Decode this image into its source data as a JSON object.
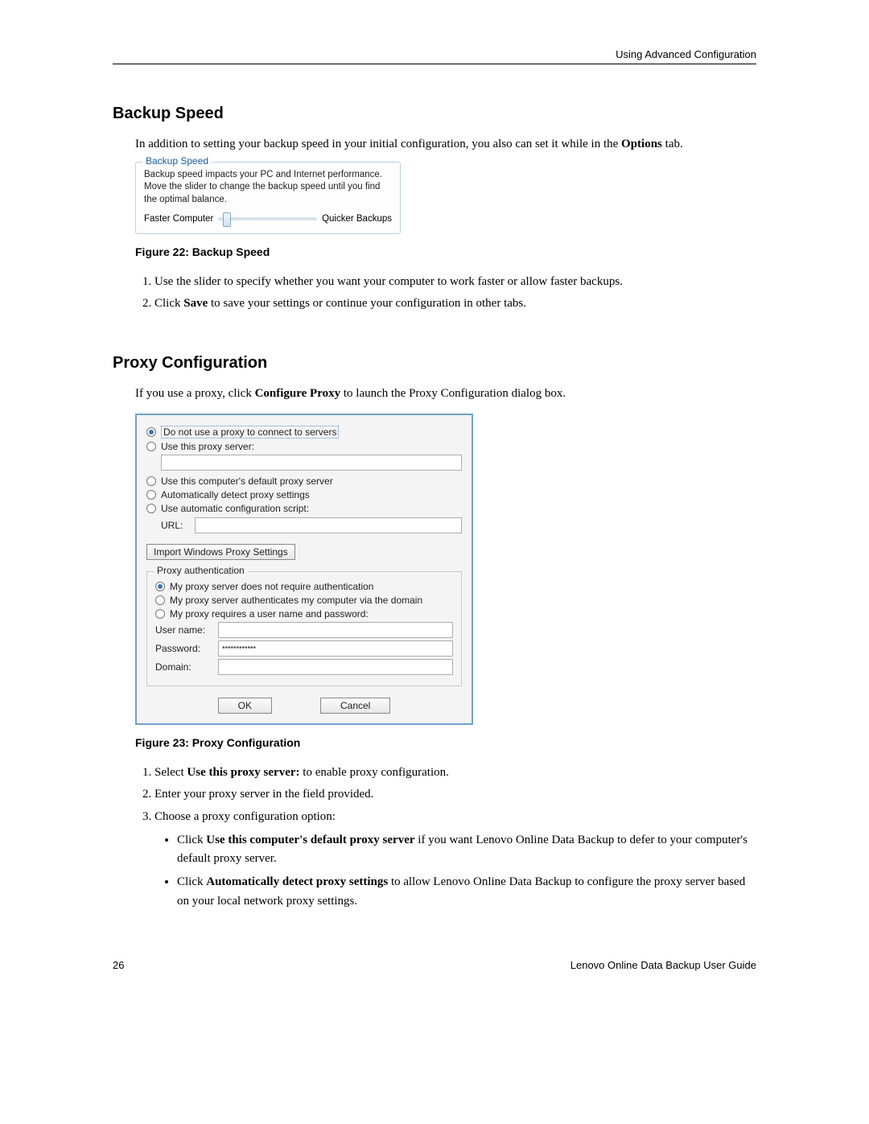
{
  "header": {
    "section": "Using Advanced Configuration"
  },
  "backup_speed": {
    "heading": "Backup Speed",
    "intro_pre": "In addition to setting your backup speed in your initial configuration, you also can set it while in the ",
    "intro_bold": "Options",
    "intro_post": " tab.",
    "fs_legend": "Backup Speed",
    "fs_desc": "Backup speed impacts your PC and Internet performance. Move the slider to change the backup speed until you find the optimal balance.",
    "slider_left": "Faster Computer",
    "slider_right": "Quicker Backups",
    "figure_caption": "Figure 22: Backup Speed",
    "step1": "Use the slider to specify whether you want your computer to work faster or allow faster backups.",
    "step2_pre": "Click ",
    "step2_bold": "Save",
    "step2_post": " to save your settings or continue your configuration in other tabs."
  },
  "proxy": {
    "heading": "Proxy Configuration",
    "intro_pre": "If you use a proxy, click ",
    "intro_bold": "Configure Proxy",
    "intro_post": " to launch the Proxy Configuration dialog box.",
    "opt_no_proxy": "Do not use a proxy to connect to servers",
    "opt_use_server": "Use this proxy server:",
    "opt_default": "Use this computer's default proxy server",
    "opt_auto_detect": "Automatically detect proxy settings",
    "opt_auto_script": "Use automatic configuration script:",
    "url_label": "URL:",
    "import_btn": "Import Windows Proxy Settings",
    "auth_legend": "Proxy authentication",
    "auth_noreq": "My proxy server does not require authentication",
    "auth_domain": "My proxy server authenticates my computer via the domain",
    "auth_userpass": "My proxy requires a user name and password:",
    "lbl_user": "User name:",
    "lbl_pass": "Password:",
    "lbl_domain": "Domain:",
    "pass_value": "••••••••••••",
    "btn_ok": "OK",
    "btn_cancel": "Cancel",
    "figure_caption": "Figure 23: Proxy Configuration",
    "step1_pre": "Select ",
    "step1_bold": "Use this proxy server:",
    "step1_post": " to enable proxy configuration.",
    "step2": "Enter your proxy server in the field provided.",
    "step3": "Choose a proxy configuration option:",
    "bullet1_pre": "Click ",
    "bullet1_bold": "Use this computer's default proxy server",
    "bullet1_post": " if you want Lenovo Online Data Backup to defer to your computer's default proxy server.",
    "bullet2_pre": "Click ",
    "bullet2_bold": "Automatically detect proxy settings",
    "bullet2_post": " to allow Lenovo Online Data Backup to configure the proxy server based on your local network proxy settings."
  },
  "footer": {
    "page_number": "26",
    "guide_title": "Lenovo Online Data Backup User Guide"
  }
}
